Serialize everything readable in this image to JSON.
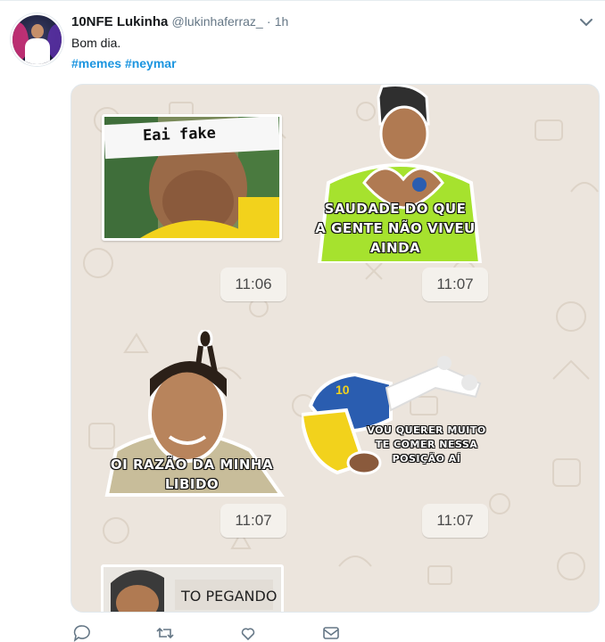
{
  "tweet": {
    "display_name": "10NFE Lukinha",
    "handle": "@lukinhaferraz_",
    "separator": "·",
    "time": "1h",
    "text": "Bom dia.",
    "hashtags": [
      "#memes",
      "#neymar"
    ]
  },
  "stickers": {
    "s1_caption": "Eai fake",
    "s2_caption_lines": [
      "SAUDADE DO QUE",
      "A GENTE NÃO VIVEU",
      "AINDA"
    ],
    "s3_caption_lines": [
      "OI RAZÃO DA MINHA",
      "LIBIDO"
    ],
    "s4_caption_lines": [
      "VOU QUERER MUITO",
      "TE COMER NESSA",
      "POSIÇÃO AÍ"
    ],
    "s5_caption": "TO PEGANDO",
    "jersey_number": "10"
  },
  "timestamps": [
    "11:06",
    "11:07",
    "11:07",
    "11:07"
  ],
  "icons": {
    "more": "chevron-down-icon",
    "reply": "reply-icon",
    "retweet": "retweet-icon",
    "like": "heart-icon",
    "message": "envelope-icon"
  },
  "colors": {
    "link": "#1b95e0",
    "name": "#14171a",
    "meta": "#657786",
    "chat_bg": "#ece5dd",
    "jersey_yellow": "#f2d21c",
    "jersey_green": "#a6e22e"
  }
}
